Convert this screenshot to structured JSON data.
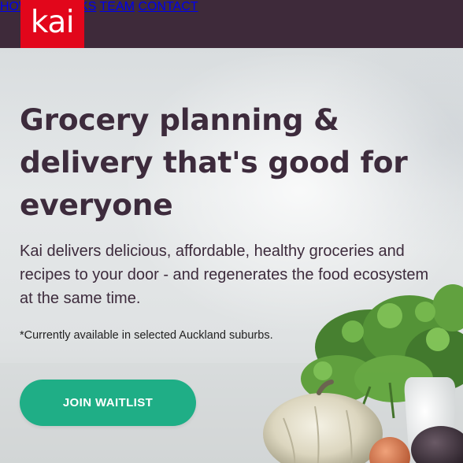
{
  "header": {
    "logo_text": "kai",
    "nav": [
      {
        "label": "HOW IT WORKS"
      },
      {
        "label": "TEAM"
      },
      {
        "label": "CONTACT"
      }
    ]
  },
  "hero": {
    "headline_lines": [
      "Grocery planning &",
      "delivery that's good for",
      "everyone"
    ],
    "subtext_lines": [
      "Kai delivers delicious, affordable, healthy groceries and",
      "recipes to your door - and regenerates the food ecosystem",
      "at the same time."
    ],
    "note": "*Currently available in selected Auckland suburbs.",
    "cta_label": "JOIN WAITLIST"
  },
  "colors": {
    "header_bg": "#3e2a3a",
    "logo_bg": "#e2061b",
    "text_primary": "#3d2b3c",
    "cta_bg": "#1fae86"
  }
}
